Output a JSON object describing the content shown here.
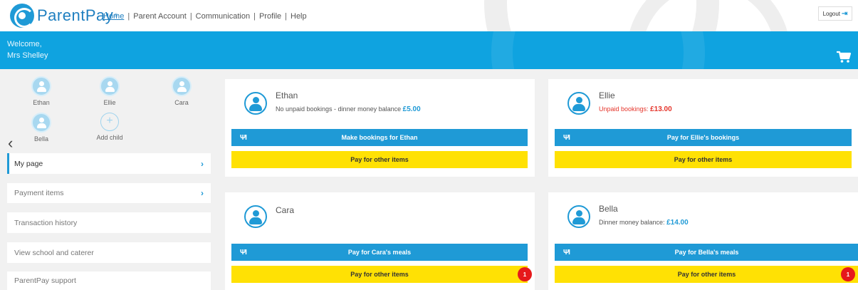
{
  "brand": {
    "name": "ParentPay",
    "reg_mark": "®"
  },
  "nav": {
    "items": [
      "Home",
      "Parent Account",
      "Communication",
      "Profile",
      "Help"
    ],
    "separator": "|",
    "active": "Home"
  },
  "logout": {
    "label": "Logout"
  },
  "welcome": {
    "line1": "Welcome,",
    "line2": "Mrs Shelley"
  },
  "children": [
    {
      "name": "Ethan"
    },
    {
      "name": "Ellie"
    },
    {
      "name": "Cara"
    },
    {
      "name": "Bella"
    }
  ],
  "add_child": {
    "label": "Add child",
    "symbol": "+"
  },
  "carousel": {
    "prev": "‹",
    "next": "›"
  },
  "sidebar": {
    "items": [
      {
        "label": "My page",
        "chevron": "›",
        "active": true
      },
      {
        "label": "Payment items",
        "chevron": "›"
      },
      {
        "label": "Transaction history"
      },
      {
        "label": "View school and caterer"
      },
      {
        "label": "ParentPay support"
      }
    ]
  },
  "cards": {
    "ethan": {
      "name": "Ethan",
      "status_text": "No unpaid bookings - dinner money balance",
      "amount": "£5.00",
      "primary_button": "Make bookings for Ethan",
      "secondary_button": "Pay for other items"
    },
    "ellie": {
      "name": "Ellie",
      "status_text": "Unpaid bookings:",
      "amount": "£13.00",
      "primary_button": "Pay for Ellie's bookings",
      "secondary_button": "Pay for other items"
    },
    "cara": {
      "name": "Cara",
      "primary_button": "Pay for Cara's meals",
      "secondary_button": "Pay for other items",
      "badge": "1"
    },
    "bella": {
      "name": "Bella",
      "status_text": "Dinner money balance:",
      "amount": "£14.00",
      "primary_button": "Pay for Bella's meals",
      "secondary_button": "Pay for other items",
      "badge": "1"
    }
  },
  "colors": {
    "brand_blue": "#1f9ad6",
    "band_blue": "#0fa3e0",
    "action_yellow": "#ffe104",
    "alert_red": "#e6191b",
    "unpaid_red": "#e5352b"
  },
  "icons": {
    "logo": "parentpay-logo-icon",
    "logout": "logout-icon",
    "cart": "shopping-cart-icon",
    "child": "user-icon",
    "meal": "fork-knife-icon",
    "add": "plus-icon",
    "chevron": "chevron-right-icon"
  }
}
